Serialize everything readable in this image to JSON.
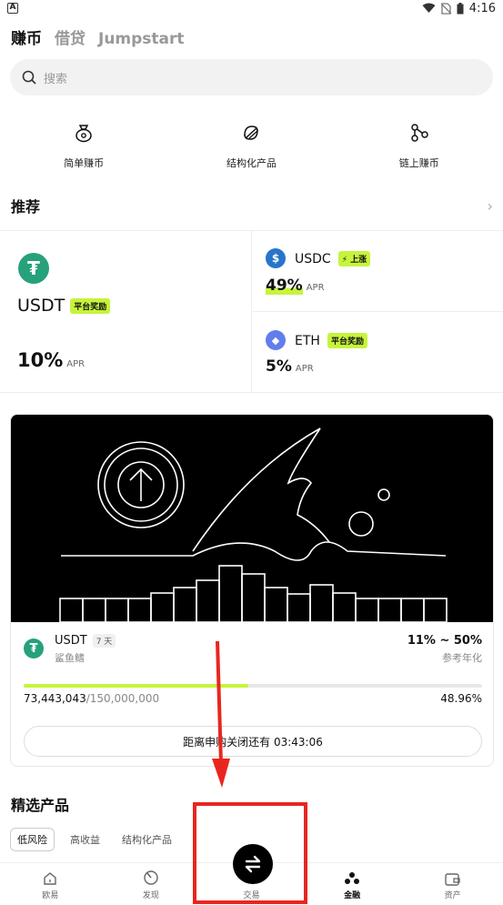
{
  "statusbar": {
    "time": "4:16"
  },
  "top_tabs": [
    "赚币",
    "借贷",
    "Jumpstart"
  ],
  "search": {
    "placeholder": "搜索"
  },
  "categories": [
    {
      "label": "简单赚币",
      "icon": "moneybag-icon"
    },
    {
      "label": "结构化产品",
      "icon": "structured-icon"
    },
    {
      "label": "链上赚币",
      "icon": "onchain-icon"
    }
  ],
  "recommend": {
    "title": "推荐",
    "main": {
      "coin": "USDT",
      "badge": "平台奖励",
      "rate": "10%",
      "apr": "APR"
    },
    "side": [
      {
        "coin": "USDC",
        "badge": "上涨",
        "rate": "49%",
        "apr": "APR"
      },
      {
        "coin": "ETH",
        "badge": "平台奖励",
        "rate": "5%",
        "apr": "APR"
      }
    ]
  },
  "promo": {
    "coin": "USDT",
    "term": "7 天",
    "product": "鲨鱼鳍",
    "rate_range": "11% ~ 50%",
    "rate_label": "参考年化",
    "raised": "73,443,043",
    "total": "/150,000,000",
    "percent": "48.96%",
    "progress": 0.4896,
    "countdown": "距离申购关闭还有 03:43:06"
  },
  "featured": {
    "title": "精选产品",
    "filters": [
      "低风险",
      "高收益",
      "结构化产品"
    ]
  },
  "bottom_nav": [
    "欧易",
    "发现",
    "交易",
    "金融",
    "资产"
  ],
  "colors": {
    "accent": "#c6f43c",
    "usdt": "#26a17b",
    "usdc": "#2775ca",
    "eth": "#627eea",
    "annotation": "#e8261f"
  }
}
